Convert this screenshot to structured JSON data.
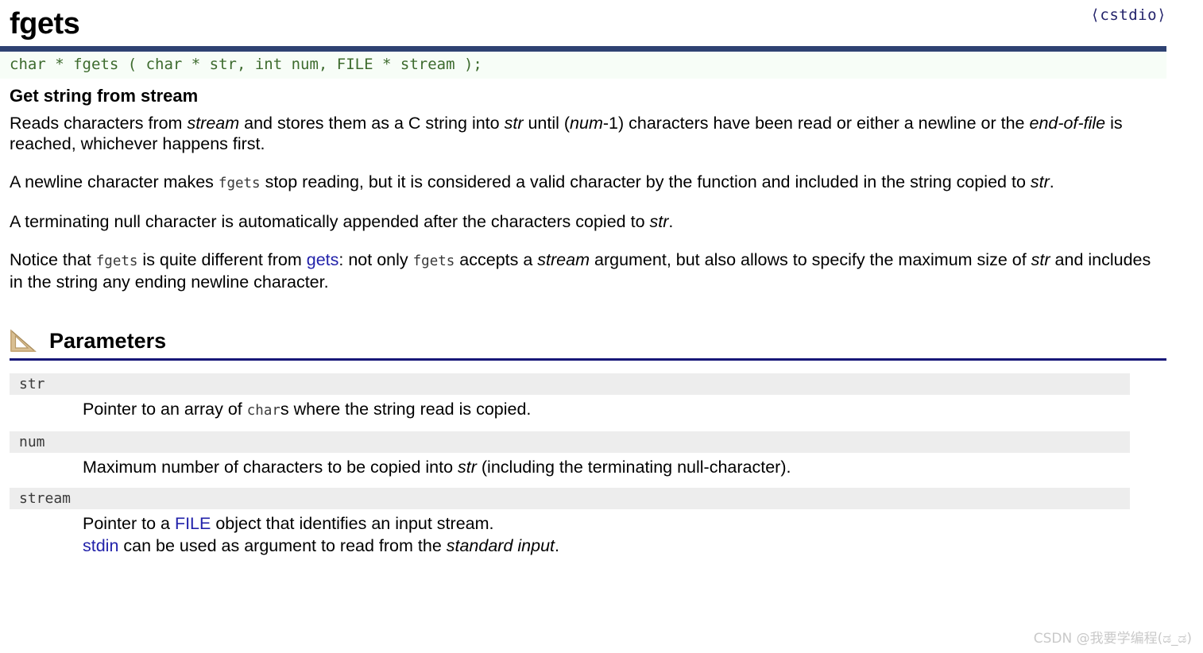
{
  "header": {
    "function_name": "fgets",
    "include": "⟨cstdio⟩"
  },
  "prototype": "char * fgets ( char * str, int num, FILE * stream );",
  "description": {
    "subtitle": "Get string from stream",
    "paragraph_1": {
      "a": "Reads characters from ",
      "em1": "stream",
      "b": " and stores them as a C string into ",
      "em2": "str",
      "c": " until (",
      "em3": "num",
      "d": "-1) characters have been read or either a newline or the ",
      "em4": "end-of-file",
      "e": " is reached, whichever happens first."
    },
    "paragraph_2": {
      "a": "A newline character makes ",
      "code1": "fgets",
      "b": " stop reading, but it is considered a valid character by the function and included in the string copied to ",
      "em1": "str",
      "c": "."
    },
    "paragraph_3": {
      "a": "A terminating null character is automatically appended after the characters copied to ",
      "em1": "str",
      "b": "."
    },
    "paragraph_4": {
      "a": "Notice that ",
      "code1": "fgets",
      "b": " is quite different from ",
      "link1": "gets",
      "c": ": not only ",
      "code2": "fgets",
      "d": " accepts a ",
      "em1": "stream",
      "e": " argument, but also allows to specify the maximum size of ",
      "em2": "str",
      "f": " and includes in the string any ending newline character."
    }
  },
  "parameters_section": {
    "title": "Parameters",
    "icon": "set-square-ruler-icon",
    "items": [
      {
        "name": "str",
        "desc": {
          "a": "Pointer to an array of ",
          "code1": "char",
          "b": "s where the string read is copied."
        }
      },
      {
        "name": "num",
        "desc": {
          "a": "Maximum number of characters to be copied into ",
          "em1": "str",
          "b": " (including the terminating null-character)."
        }
      },
      {
        "name": "stream",
        "desc": {
          "line1_a": "Pointer to a ",
          "line1_link": "FILE",
          "line1_b": " object that identifies an input stream.",
          "line2_link": "stdin",
          "line2_a": " can be used as argument to read from the ",
          "line2_em": "standard input",
          "line2_b": "."
        }
      }
    ]
  },
  "watermark": "CSDN @我要学编程(ಡ_ಡ)",
  "colors": {
    "rule_navy": "#2e4272",
    "section_rule": "#171778",
    "prototype_bg": "#f7fdf7",
    "prototype_text": "#3d6b2e",
    "param_band": "#ededed",
    "link": "#2222aa",
    "include_text": "#23236b",
    "watermark": "#c9c9c9"
  }
}
